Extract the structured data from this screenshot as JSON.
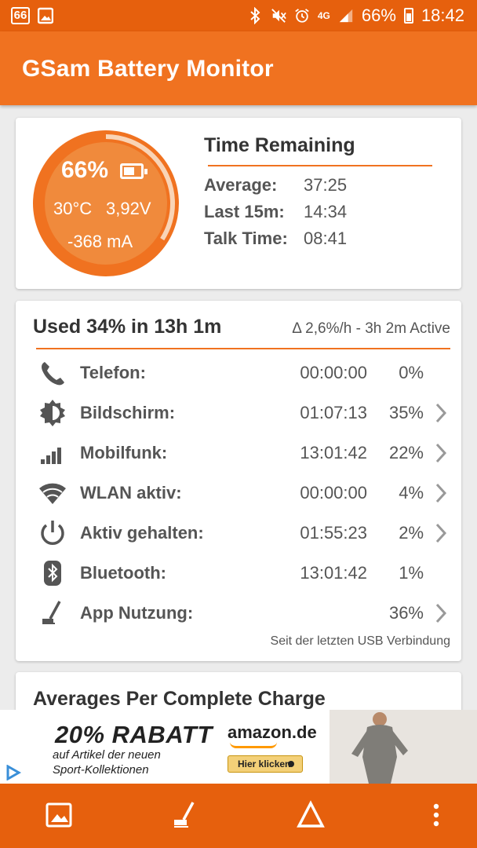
{
  "status_bar": {
    "left_badge": "66",
    "network": "4G",
    "battery_pct": "66%",
    "time": "18:42"
  },
  "app": {
    "title": "GSam Battery Monitor"
  },
  "gauge": {
    "percent": "66%",
    "level": 0.66,
    "temperature": "30°C",
    "voltage": "3,92V",
    "current": "-368 mA"
  },
  "time_remaining": {
    "title": "Time Remaining",
    "rows": [
      {
        "label": "Average:",
        "value": "37:25"
      },
      {
        "label": "Last 15m:",
        "value": "14:34"
      },
      {
        "label": "Talk Time:",
        "value": "08:41"
      }
    ]
  },
  "usage": {
    "title": "Used 34% in 13h 1m",
    "rate": "Δ 2,6%/h - 3h 2m Active",
    "rows": [
      {
        "icon": "phone-icon",
        "label": "Telefon:",
        "time": "00:00:00",
        "pct": "0%",
        "chevron": false
      },
      {
        "icon": "brightness-icon",
        "label": "Bildschirm:",
        "time": "01:07:13",
        "pct": "35%",
        "chevron": true
      },
      {
        "icon": "signal-bars-icon",
        "label": "Mobilfunk:",
        "time": "13:01:42",
        "pct": "22%",
        "chevron": true
      },
      {
        "icon": "wifi-icon",
        "label": "WLAN aktiv:",
        "time": "00:00:00",
        "pct": "4%",
        "chevron": true
      },
      {
        "icon": "power-icon",
        "label": "Aktiv gehalten:",
        "time": "01:55:23",
        "pct": "2%",
        "chevron": true
      },
      {
        "icon": "bluetooth-icon",
        "label": "Bluetooth:",
        "time": "13:01:42",
        "pct": "1%",
        "chevron": false
      },
      {
        "icon": "app-usage-icon",
        "label": "App Nutzung:",
        "time": "",
        "pct": "36%",
        "chevron": true
      }
    ],
    "footnote": "Seit der letzten USB Verbindung"
  },
  "averages": {
    "title": "Averages Per Complete Charge"
  },
  "ad": {
    "headline": "20% RABATT",
    "subline_1": "auf Artikel der neuen",
    "subline_2": "Sport-Kollektionen",
    "brand": "amazon.de",
    "button": "Hier klicken"
  },
  "bottom_bar": {
    "icons": [
      "image-icon",
      "app-usage-icon",
      "delta-icon",
      "more-vert-icon"
    ]
  },
  "colors": {
    "accent": "#f07220",
    "status_bar": "#e6600d",
    "gauge_fill": "#f08a3c",
    "text": "#555555"
  }
}
